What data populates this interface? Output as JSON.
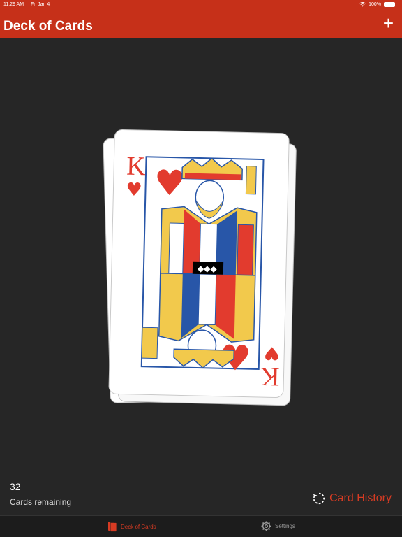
{
  "status": {
    "time": "11:29 AM",
    "date": "Fri Jan 4",
    "battery": "100%"
  },
  "nav": {
    "title": "Deck of Cards",
    "add_label": "+"
  },
  "card": {
    "rank": "K",
    "suit": "hearts",
    "suit_symbol": "♥"
  },
  "stats": {
    "count": "32",
    "label": "Cards remaining"
  },
  "history": {
    "label": "Card History"
  },
  "tabs": [
    {
      "label": "Deck of Cards",
      "icon": "deck-icon",
      "active": true
    },
    {
      "label": "Settings",
      "icon": "gear-icon",
      "active": false
    }
  ],
  "colors": {
    "accent": "#c63019",
    "background": "#262626",
    "card_red": "#e23b2e",
    "card_blue": "#2856a8",
    "card_gold": "#f2c94c"
  }
}
